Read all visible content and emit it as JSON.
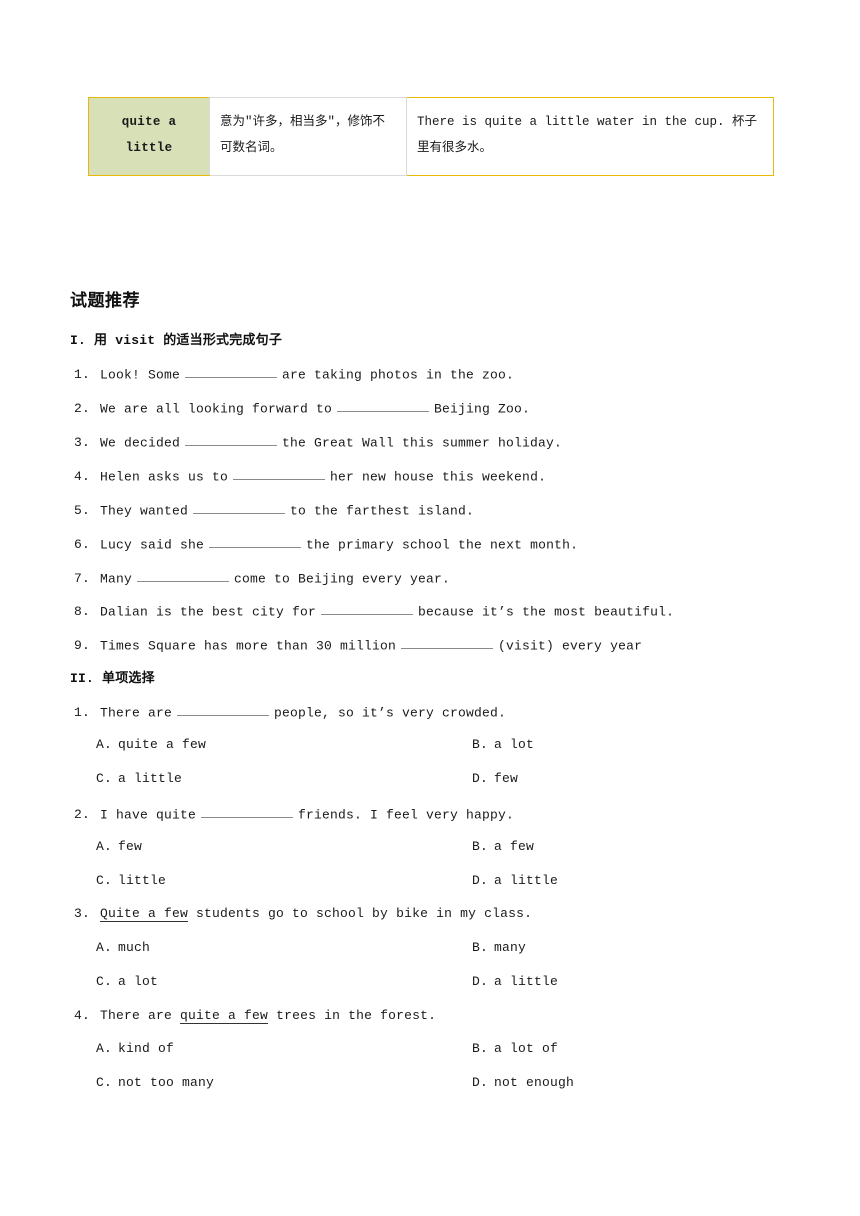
{
  "grammar_table": {
    "rows": [
      {
        "term_lines": [
          "quite a",
          "little"
        ],
        "meaning": "意为\"许多，相当多\"，修饰不可数名词。",
        "example": "There is quite a little water in the cup. 杯子里有很多水。"
      }
    ],
    "border_color": "#e8b90b",
    "term_bg_color": "#d7e0b6"
  },
  "section": {
    "title": "试题推荐"
  },
  "parts": [
    {
      "heading": "I.  用 visit 的适当形式完成句子"
    },
    {
      "heading": "II.  单项选择"
    }
  ],
  "fill_in_blanks": [
    {
      "num": "1.",
      "before": "Look! Some",
      "after": "are taking photos in the zoo."
    },
    {
      "num": "2.",
      "before": "We are all looking forward to",
      "after": "Beijing Zoo."
    },
    {
      "num": "3.",
      "before": "We decided",
      "after": "the Great Wall this summer holiday."
    },
    {
      "num": "4.",
      "before": "Helen asks us to",
      "after": "her new house this weekend."
    },
    {
      "num": "5.",
      "before": "They wanted",
      "after": "to the farthest island."
    },
    {
      "num": "6.",
      "before": "Lucy said she",
      "after": "the primary school the next month."
    },
    {
      "num": "7.",
      "before": "Many",
      "after": "come to Beijing every year."
    },
    {
      "num": "8.",
      "before": "Dalian is the best city for",
      "after": "because it’s the most beautiful."
    },
    {
      "num": "9.",
      "before": "Times Square has more than 30 million",
      "after": "(visit) every year"
    }
  ],
  "multiple_choice": [
    {
      "num": "1.",
      "stem_before": "There are",
      "stem_blank": true,
      "stem_underline": "",
      "stem_after": "people, so it’s very crowded.",
      "options": [
        {
          "key": "A.",
          "text": "quite a few"
        },
        {
          "key": "B.",
          "text": "a lot"
        },
        {
          "key": "C.",
          "text": "a little"
        },
        {
          "key": "D.",
          "text": "few"
        }
      ]
    },
    {
      "num": "2.",
      "stem_before": "I have quite",
      "stem_blank": true,
      "stem_underline": "",
      "stem_after": "friends. I feel very happy.",
      "options": [
        {
          "key": "A.",
          "text": "few"
        },
        {
          "key": "B.",
          "text": "a few"
        },
        {
          "key": "C.",
          "text": "little"
        },
        {
          "key": "D.",
          "text": "a little"
        }
      ]
    },
    {
      "num": "3.",
      "stem_before": "",
      "stem_blank": false,
      "stem_underline": "Quite a few",
      "stem_after": "students go to school by bike in my class.",
      "options": [
        {
          "key": "A.",
          "text": "much"
        },
        {
          "key": "B.",
          "text": "many"
        },
        {
          "key": "C.",
          "text": "a lot"
        },
        {
          "key": "D.",
          "text": "a little"
        }
      ]
    },
    {
      "num": "4.",
      "stem_before": "There are",
      "stem_blank": false,
      "stem_underline": "quite a few",
      "stem_after": "trees in the forest.",
      "options": [
        {
          "key": "A.",
          "text": "kind of"
        },
        {
          "key": "B.",
          "text": "a lot of"
        },
        {
          "key": "C.",
          "text": "not too many"
        },
        {
          "key": "D.",
          "text": "not enough"
        }
      ]
    }
  ]
}
